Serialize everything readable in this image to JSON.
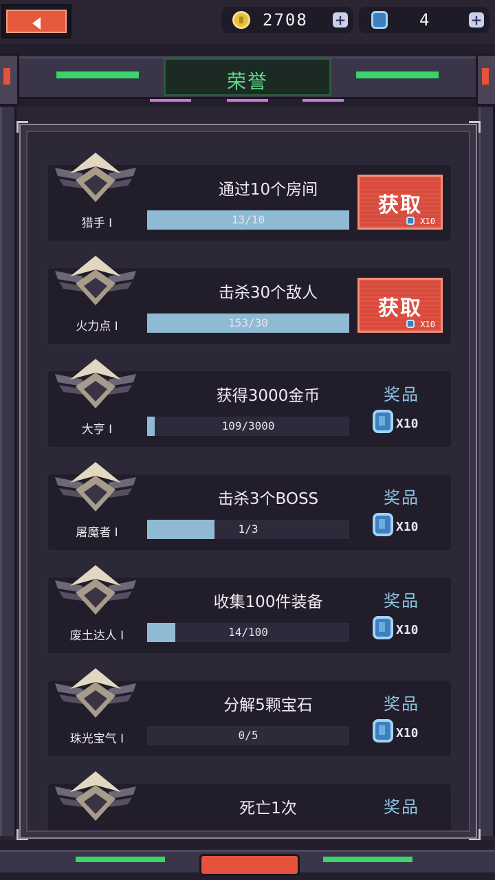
{
  "header": {
    "title": "荣誉",
    "coins": "2708",
    "gems": "4"
  },
  "colors": {
    "accent_green": "#5fdc8a",
    "claim_red": "#d94b3d",
    "progress_fill": "#8fbad3",
    "reward_blue": "#8ec5e3"
  },
  "achievements": [
    {
      "title": "通过10个房间",
      "rank": "猎手 I",
      "progress": "13/10",
      "fraction": 1.0,
      "claimable": true,
      "action": "获取",
      "reward_amount": "X10"
    },
    {
      "title": "击杀30个敌人",
      "rank": "火力点 I",
      "progress": "153/30",
      "fraction": 1.0,
      "claimable": true,
      "action": "获取",
      "reward_amount": "X10"
    },
    {
      "title": "获得3000金币",
      "rank": "大亨 I",
      "progress": "109/3000",
      "fraction": 0.036,
      "claimable": false,
      "reward_label": "奖品",
      "reward_amount": "X10"
    },
    {
      "title": "击杀3个BOSS",
      "rank": "屠魔者 I",
      "progress": "1/3",
      "fraction": 0.333,
      "claimable": false,
      "reward_label": "奖品",
      "reward_amount": "X10"
    },
    {
      "title": "收集100件装备",
      "rank": "废土达人 I",
      "progress": "14/100",
      "fraction": 0.14,
      "claimable": false,
      "reward_label": "奖品",
      "reward_amount": "X10"
    },
    {
      "title": "分解5颗宝石",
      "rank": "珠光宝气 I",
      "progress": "0/5",
      "fraction": 0.0,
      "claimable": false,
      "reward_label": "奖品",
      "reward_amount": "X10"
    },
    {
      "title": "死亡1次",
      "rank": "",
      "progress": "",
      "fraction": 0.0,
      "claimable": false,
      "reward_label": "奖品",
      "reward_amount": ""
    }
  ]
}
